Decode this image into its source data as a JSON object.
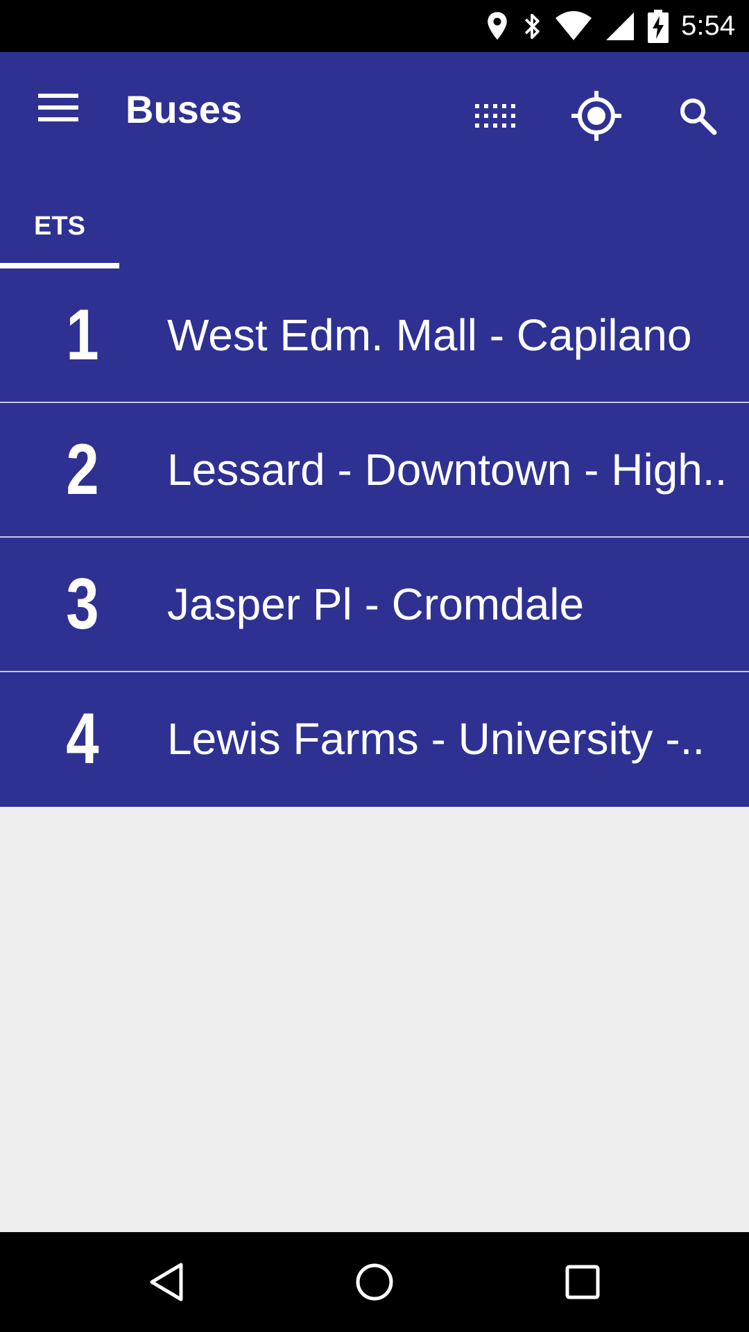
{
  "status_bar": {
    "time": "5:54",
    "icons": [
      "location-icon",
      "bluetooth-icon",
      "wifi-icon",
      "cell-signal-icon",
      "battery-charging-icon"
    ]
  },
  "app_bar": {
    "title": "Buses",
    "actions": [
      "grid-icon",
      "my-location-icon",
      "search-icon"
    ]
  },
  "tabs": [
    {
      "label": "ETS",
      "selected": true
    }
  ],
  "routes": [
    {
      "number": "1",
      "name": "West Edm. Mall - Capilano"
    },
    {
      "number": "2",
      "name": "Lessard - Downtown - High.."
    },
    {
      "number": "3",
      "name": "Jasper Pl - Cromdale"
    },
    {
      "number": "4",
      "name": "Lewis Farms - University -.."
    }
  ],
  "nav_bar": {
    "buttons": [
      "back-icon",
      "home-icon",
      "recents-icon"
    ]
  },
  "colors": {
    "primary": "#2e3192",
    "background": "#eeeeee",
    "divider": "#c9cae6"
  }
}
